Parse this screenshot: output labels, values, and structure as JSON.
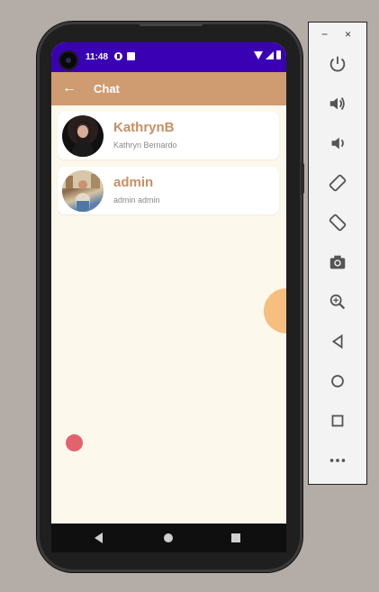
{
  "status_bar": {
    "time": "11:48"
  },
  "app_bar": {
    "back_icon": "arrow-left-icon",
    "title": "Chat"
  },
  "chats": [
    {
      "username": "KathrynB",
      "full_name": "Kathryn Bernardo"
    },
    {
      "username": "admin",
      "full_name": "admin admin"
    }
  ],
  "emulator_panel": {
    "window_controls": [
      "−",
      "×"
    ],
    "tools": [
      "power-icon",
      "volume-up-icon",
      "volume-down-icon",
      "rotate-left-icon",
      "rotate-right-icon",
      "camera-icon",
      "zoom-icon",
      "back-icon",
      "home-icon",
      "overview-icon",
      "more-icon"
    ]
  },
  "colors": {
    "status_bar": "#3a00b4",
    "app_bar": "#cf9b71",
    "background": "#fdf8ec",
    "accent_text": "#c88f63",
    "orange_circle": "#f6be7f",
    "red_dot": "#e2626e"
  }
}
